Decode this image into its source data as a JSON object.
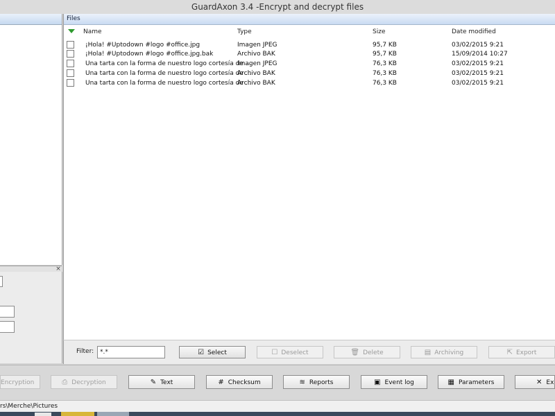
{
  "window": {
    "title": "GuardAxon 3.4 -Encrypt and decrypt files"
  },
  "files_panel": {
    "title": "Files",
    "columns": {
      "name": "Name",
      "type": "Type",
      "size": "Size",
      "date": "Date modified"
    },
    "rows": [
      {
        "name": "¡Hola! #Uptodown #logo #office.jpg",
        "type": "Imagen JPEG",
        "size": "95,7 KB",
        "date": "03/02/2015 9:21"
      },
      {
        "name": "¡Hola! #Uptodown #logo #office.jpg.bak",
        "type": "Archivo BAK",
        "size": "95,7 KB",
        "date": "15/09/2014 10:27"
      },
      {
        "name": "Una tarta con la forma de nuestro logo cortesía de ...",
        "type": "Imagen JPEG",
        "size": "76,3 KB",
        "date": "03/02/2015 9:21"
      },
      {
        "name": "Una tarta con la forma de nuestro logo cortesía de ...",
        "type": "Archivo BAK",
        "size": "76,3 KB",
        "date": "03/02/2015 9:21"
      },
      {
        "name": "Una tarta con la forma de nuestro logo cortesía de ...",
        "type": "Archivo BAK",
        "size": "76,3 KB",
        "date": "03/02/2015 9:21"
      }
    ]
  },
  "filter": {
    "label": "Filter:",
    "value": "*.*"
  },
  "file_actions": {
    "select": "Select",
    "deselect": "Deselect",
    "delete": "Delete",
    "archiving": "Archiving",
    "export": "Export"
  },
  "main_actions": {
    "encryption": "Encryption",
    "decryption": "Decryption",
    "text": "Text",
    "checksum": "Checksum",
    "reports": "Reports",
    "event_log": "Event log",
    "parameters": "Parameters",
    "exit": "Ex"
  },
  "status": {
    "path": "rs\\Merche\\Pictures"
  },
  "icons": {
    "sort": "sort-desc-icon",
    "select": "checkbox-icon",
    "text": "pen-icon",
    "checksum": "hash-icon",
    "reports": "database-icon",
    "event_log": "log-icon",
    "parameters": "parameters-icon",
    "exit": "close-icon"
  },
  "colors": {
    "header_blue": "#c9dbf2",
    "sort_green": "#2e9a2e"
  }
}
